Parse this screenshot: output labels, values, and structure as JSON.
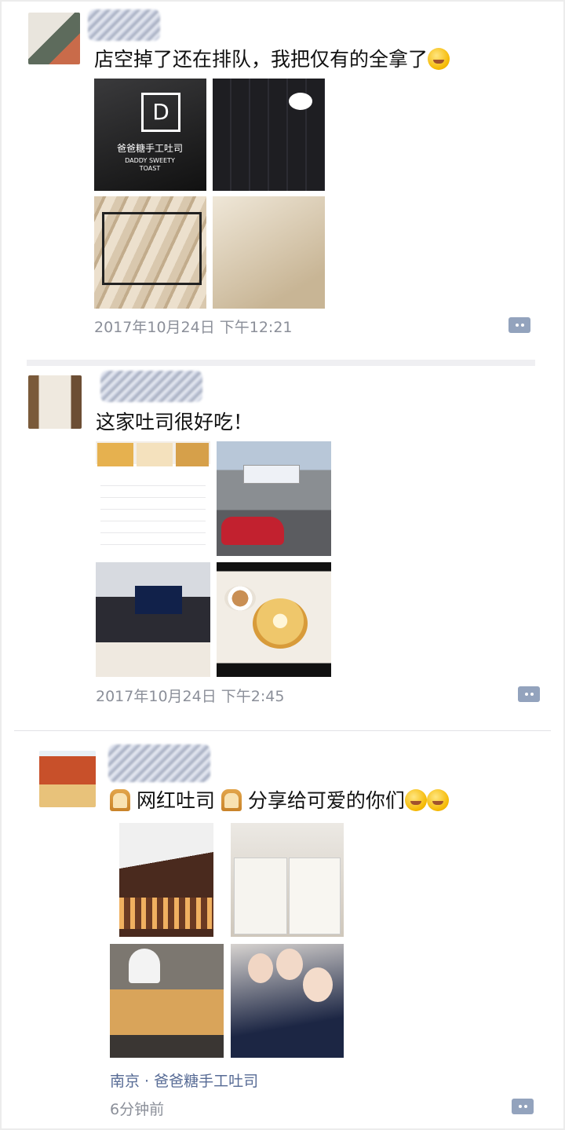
{
  "posts": [
    {
      "text": "店空掉了还在排队，我把仅有的全拿了",
      "time": "2017年10月24日 下午12:21",
      "sign": {
        "line1": "爸爸糖手工吐司",
        "line2": "DADDY SWEETY",
        "line3": "TOAST"
      }
    },
    {
      "text": "这家吐司很好吃！",
      "time": "2017年10月24日 下午2:45"
    },
    {
      "text_main": "网红吐司",
      "text_tail": "分享给可爱的你们",
      "location": "南京 · 爸爸糖手工吐司",
      "time": "6分钟前"
    }
  ],
  "icons": {
    "comment": "comment-bubble-icon",
    "emoji_laugh": "laughing-emoji-icon",
    "emoji_smirk": "smirk-emoji-icon",
    "emoji_hug": "hug-emoji-icon",
    "bread": "bread-emoji-icon"
  },
  "colors": {
    "time_gray": "#8b8f99",
    "link_blue": "#576b95",
    "comment_icon": "#93a3bd"
  }
}
